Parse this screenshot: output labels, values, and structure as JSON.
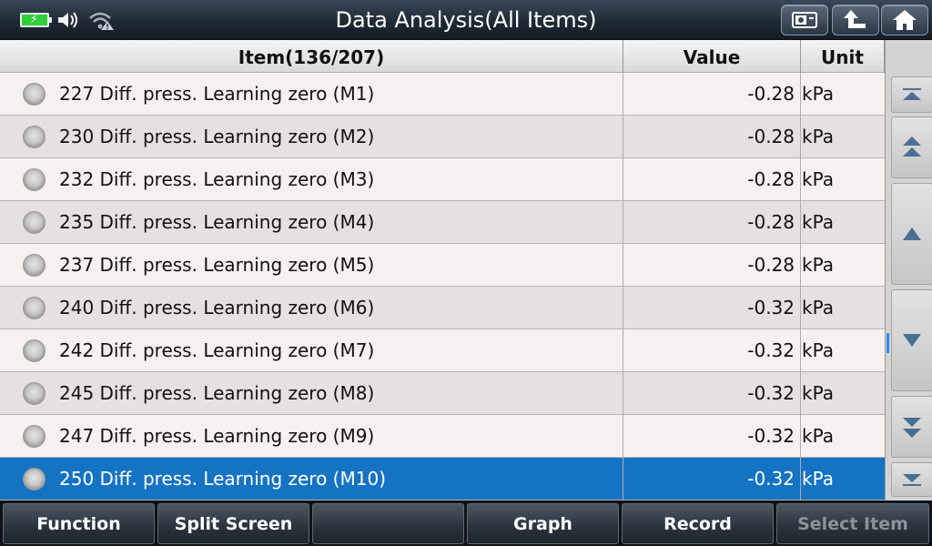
{
  "header": {
    "title": "Data Analysis(All Items)"
  },
  "table": {
    "columns": {
      "item": "Item(136/207)",
      "value": "Value",
      "unit": "Unit"
    },
    "rows": [
      {
        "name": "227 Diff. press. Learning zero (M1)",
        "value": "-0.28",
        "unit": "kPa"
      },
      {
        "name": "230 Diff. press. Learning zero (M2)",
        "value": "-0.28",
        "unit": "kPa"
      },
      {
        "name": "232 Diff. press. Learning zero (M3)",
        "value": "-0.28",
        "unit": "kPa"
      },
      {
        "name": "235 Diff. press. Learning zero (M4)",
        "value": "-0.28",
        "unit": "kPa"
      },
      {
        "name": "237 Diff. press. Learning zero (M5)",
        "value": "-0.28",
        "unit": "kPa"
      },
      {
        "name": "240 Diff. press. Learning zero (M6)",
        "value": "-0.32",
        "unit": "kPa"
      },
      {
        "name": "242 Diff. press. Learning zero (M7)",
        "value": "-0.32",
        "unit": "kPa"
      },
      {
        "name": "245 Diff. press. Learning zero (M8)",
        "value": "-0.32",
        "unit": "kPa"
      },
      {
        "name": "247 Diff. press. Learning zero (M9)",
        "value": "-0.32",
        "unit": "kPa"
      },
      {
        "name": "250 Diff. press. Learning zero (M10)",
        "value": "-0.32",
        "unit": "kPa"
      }
    ],
    "selected_index": 9
  },
  "toolbar": {
    "buttons": [
      "Function",
      "Split Screen",
      "",
      "Graph",
      "Record",
      "Select Item"
    ]
  },
  "colors": {
    "selected_row": "#1573c4",
    "battery": "#2fcf3a"
  }
}
